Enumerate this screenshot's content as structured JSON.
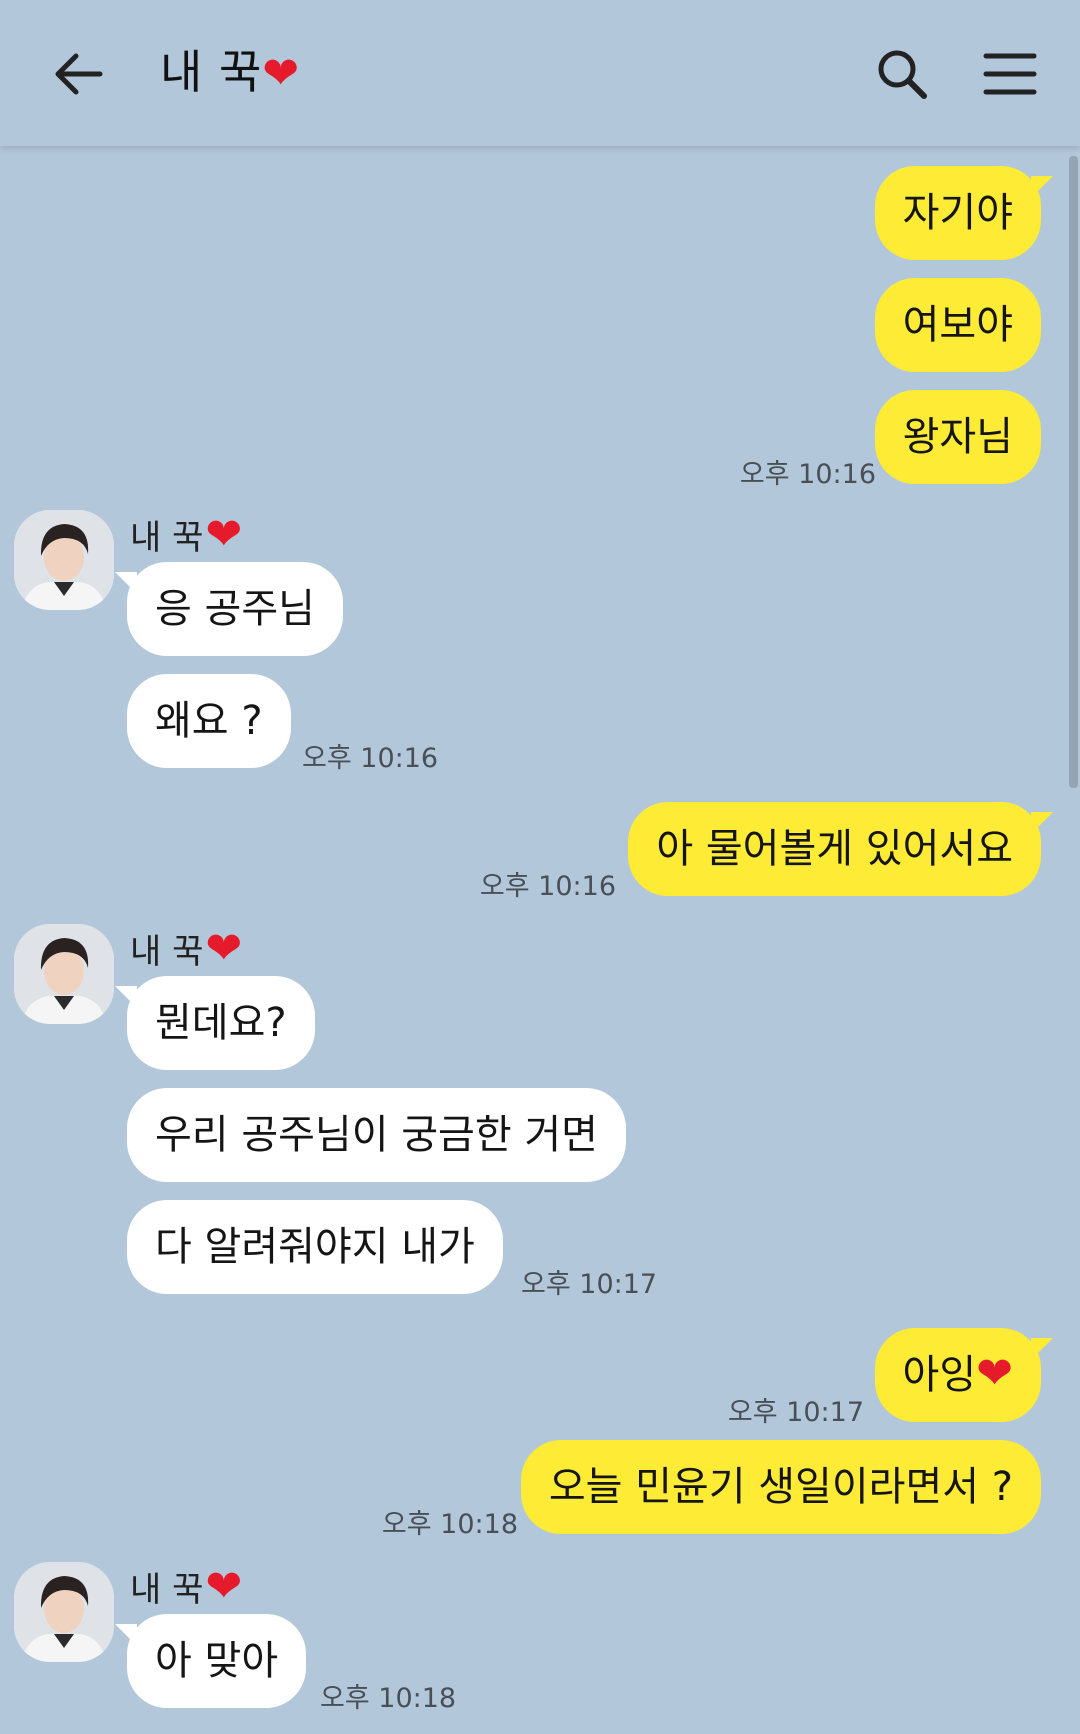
{
  "header": {
    "title": "내 꾹",
    "back_icon": "arrow-left-icon",
    "search_icon": "search-icon",
    "menu_icon": "hamburger-menu-icon"
  },
  "colors": {
    "background": "#b2c7da",
    "outgoing_bubble": "#fdeb36",
    "incoming_bubble": "#ffffff",
    "heart": "#e51a2a"
  },
  "contact": {
    "name": "내 꾹"
  },
  "messages": [
    {
      "dir": "out",
      "text": "자기야"
    },
    {
      "dir": "out",
      "text": "여보야"
    },
    {
      "dir": "out",
      "text": "왕자님",
      "time": "오후 10:16"
    },
    {
      "dir": "in",
      "text": "응 공주님"
    },
    {
      "dir": "in",
      "text": "왜요 ?",
      "time": "오후 10:16"
    },
    {
      "dir": "out",
      "text": "아 물어볼게 있어서요",
      "time": "오후 10:16"
    },
    {
      "dir": "in",
      "text": "뭔데요?"
    },
    {
      "dir": "in",
      "text": "우리 공주님이 궁금한 거면"
    },
    {
      "dir": "in",
      "text": "다 알려줘야지 내가",
      "time": "오후 10:17"
    },
    {
      "dir": "out",
      "text": "아잉",
      "time": "오후 10:17"
    },
    {
      "dir": "out",
      "text": "오늘 민윤기 생일이라면서 ?",
      "time": "오후 10:18"
    },
    {
      "dir": "in",
      "text": "아 맞아",
      "time": "오후 10:18"
    }
  ]
}
